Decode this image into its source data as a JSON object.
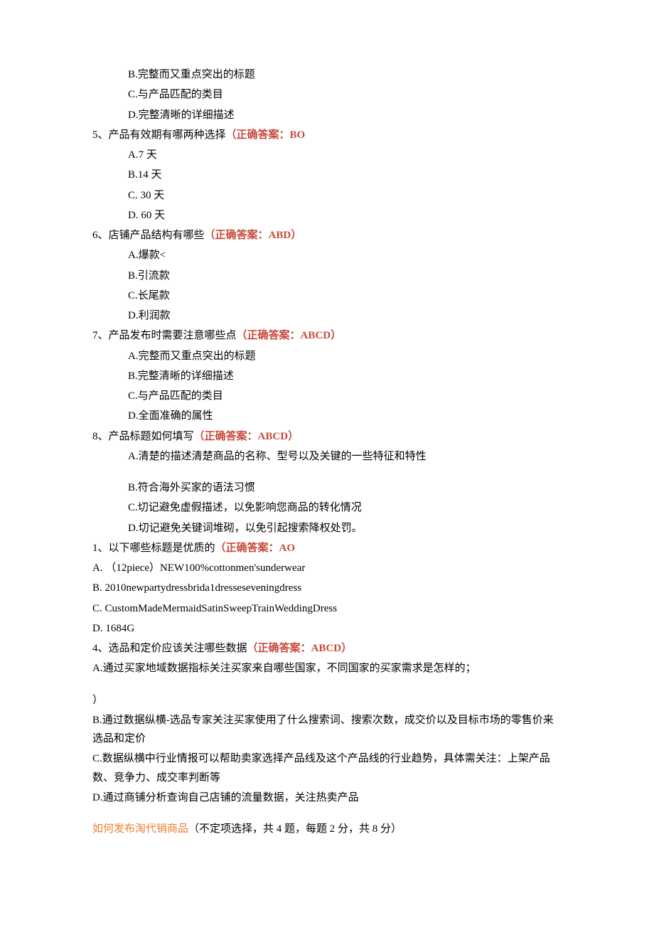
{
  "top_options": {
    "b": "B.完整而又重点突出的标题",
    "c": "C.与产品匹配的类目",
    "d": "D.完整清晰的详细描述"
  },
  "q5": {
    "num": "5、",
    "text": "产品有效期有哪两种选择",
    "ans_open": "（正确答案：",
    "ans_val": "BO",
    "opts": {
      "a": "A.7 天",
      "b": "B.14 天",
      "c": "C.   30 天",
      "d": "D.   60 天"
    }
  },
  "q6": {
    "num": "6、",
    "text": "店铺产品结构有哪些",
    "ans_open": "（正确答案：",
    "ans_val": "ABD",
    "ans_close": "）",
    "opts": {
      "a": "A.爆款<",
      "b": "B.引流款",
      "c": "C.长尾款",
      "d": "D.利润款"
    }
  },
  "q7": {
    "num": "7、",
    "text": "产品发布时需要注意哪些点",
    "ans_open": "（正确答案：",
    "ans_val": "ABCD",
    "ans_close": "）",
    "opts": {
      "a": "A.完整而又重点突出的标题",
      "b": "B.完整清晰的详细描述",
      "c": "C.与产品匹配的类目",
      "d": "D.全面准确的属性"
    }
  },
  "q8": {
    "num": "8、",
    "text": "产品标题如何填写",
    "ans_open": "（正确答案：",
    "ans_val": "ABCD",
    "ans_close": "）",
    "opts": {
      "a": "A.清楚的描述清楚商品的名称、型号以及关键的一些特征和特性",
      "b": "B.符合海外买家的语法习惯",
      "c": "C.切记避免虚假描述，以免影响您商品的转化情况",
      "d": "D.切记避免关键词堆砌，以免引起搜索降权处罚。"
    }
  },
  "q1": {
    "num": "1、",
    "text": "以下哪些标题是优质的",
    "ans_open": "（正确答案：",
    "ans_val": "AO",
    "opts": {
      "a": "A.   （12piece）NEW100%cottonmen'sunderwear",
      "b": "B.    2010newpartydressbrida1dresseseveningdress",
      "c": "C.    CustomMadeMermaidSatinSweepTrainWeddingDress",
      "d": "D.    1684G"
    }
  },
  "q4": {
    "num": "4、",
    "text": "选品和定价应该关注哪些数据",
    "ans_open": "（正确答案：",
    "ans_val": "ABCD",
    "ans_close": "）",
    "opts": {
      "a1": "A.通过买家地域数据指标关注买家来自哪些国家，不同国家的买家需求是怎样的；",
      "a2": "）",
      "b": "B.通过数据纵横-选品专家关注买家使用了什么搜索词、搜索次数，成交价以及目标市场的零售价来选品和定价",
      "c": "C.数据纵横中行业情报可以帮助卖家选择产品线及这个产品线的行业趋势，具体需关注：上架产品数、竞争力、成交率判断等",
      "d": "D.通过商铺分析查询自己店铺的流量数据，关注热卖产品"
    }
  },
  "section": {
    "title": "如何发布淘代销商品",
    "note": "（不定项选择，共 4 题，每题 2 分，共 8 分）"
  }
}
